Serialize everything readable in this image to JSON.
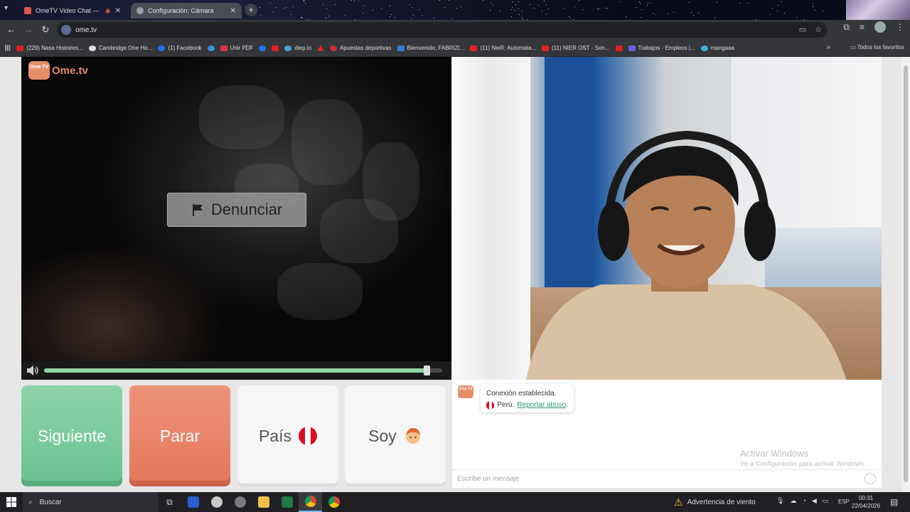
{
  "browser": {
    "tabs": [
      {
        "title": "OmeTV Video Chat — Om",
        "favicon_color": "#e0564a",
        "active": true
      },
      {
        "title": "Configuración: Cámara",
        "favicon_color": "#9aa0a6",
        "active": false
      }
    ],
    "address": "ome.tv",
    "bookmarks": [
      {
        "label": "(229) Nasa Histoires...",
        "icon": "youtube-icon"
      },
      {
        "label": "Cambridge One Ho...",
        "icon": "globe-icon"
      },
      {
        "label": "(1) Facebook",
        "icon": "facebook-icon"
      },
      {
        "label": "",
        "icon": "site-icon"
      },
      {
        "label": "Unir PDF",
        "icon": "pdf-icon"
      },
      {
        "label": "",
        "icon": "facebook-icon"
      },
      {
        "label": "",
        "icon": "youtube-icon"
      },
      {
        "label": "diep.io",
        "icon": "diep-icon"
      },
      {
        "label": "",
        "icon": "warning-icon"
      },
      {
        "label": "Apuestas deportivas",
        "icon": "betting-icon"
      },
      {
        "label": "Bienvenido, FABRIZI...",
        "icon": "site-icon"
      },
      {
        "label": "(11) NieR: Automata...",
        "icon": "youtube-icon"
      },
      {
        "label": "(11) NIER OST - Son...",
        "icon": "youtube-icon"
      },
      {
        "label": "",
        "icon": "youtube-icon"
      },
      {
        "label": "Trabajos - Empleos |...",
        "icon": "site-icon"
      },
      {
        "label": "mangaaa",
        "icon": "site-icon"
      }
    ],
    "all_bookmarks": "Todos los favoritos"
  },
  "page": {
    "logo_word": "Ome.tv",
    "logo_mark": "Ome TV",
    "report_button": "Denunciar",
    "volume_level": 0.96,
    "controls": {
      "next": "Siguiente",
      "stop": "Parar",
      "country": "País",
      "gender": "Soy"
    },
    "chat": {
      "logo_mark": "Ome TV",
      "status": "Conexión establecida.",
      "country": "Perú.",
      "report_abuse": "Reportar abuso",
      "period": ".",
      "input_placeholder": "Escribe un mensaje",
      "activate_title": "Activar Windows",
      "activate_sub": "Ve a Configuración para activar Windows."
    }
  },
  "colors": {
    "accent_green": "#6ac390",
    "accent_red": "#e4765b",
    "brand_orange": "#e58f6a",
    "peru_red": "#d91023"
  },
  "taskbar": {
    "search": "Buscar",
    "weather": "Advertencia de viento",
    "lang": "ESP",
    "time": "00:31",
    "date": "22/04/2026"
  }
}
